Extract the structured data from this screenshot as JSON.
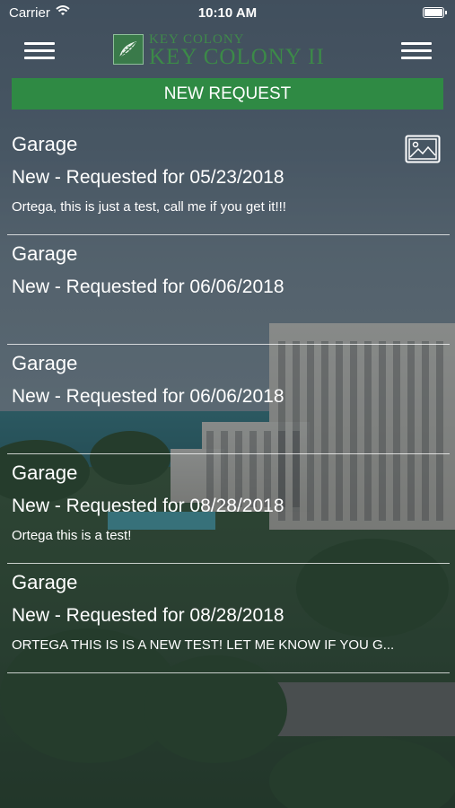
{
  "status_bar": {
    "carrier": "Carrier",
    "time": "10:10 AM"
  },
  "header": {
    "logo_line1": "KEY COLONY",
    "logo_line2": "KEY COLONY II"
  },
  "new_request_label": "NEW REQUEST",
  "requests": [
    {
      "title": "Garage",
      "status": "New - Requested for 05/23/2018",
      "note": "Ortega, this is just a test, call me if you get it!!!",
      "has_photo": true
    },
    {
      "title": "Garage",
      "status": "New - Requested for 06/06/2018",
      "note": ""
    },
    {
      "title": "Garage",
      "status": "New - Requested for 06/06/2018",
      "note": ""
    },
    {
      "title": "Garage",
      "status": "New - Requested for 08/28/2018",
      "note": "Ortega this is a test!"
    },
    {
      "title": "Garage",
      "status": "New - Requested for 08/28/2018",
      "note": "ORTEGA THIS IS IS A NEW TEST! LET ME KNOW IF YOU G..."
    }
  ],
  "colors": {
    "accent": "#2f8a44",
    "logo_green": "#3c8a48"
  }
}
